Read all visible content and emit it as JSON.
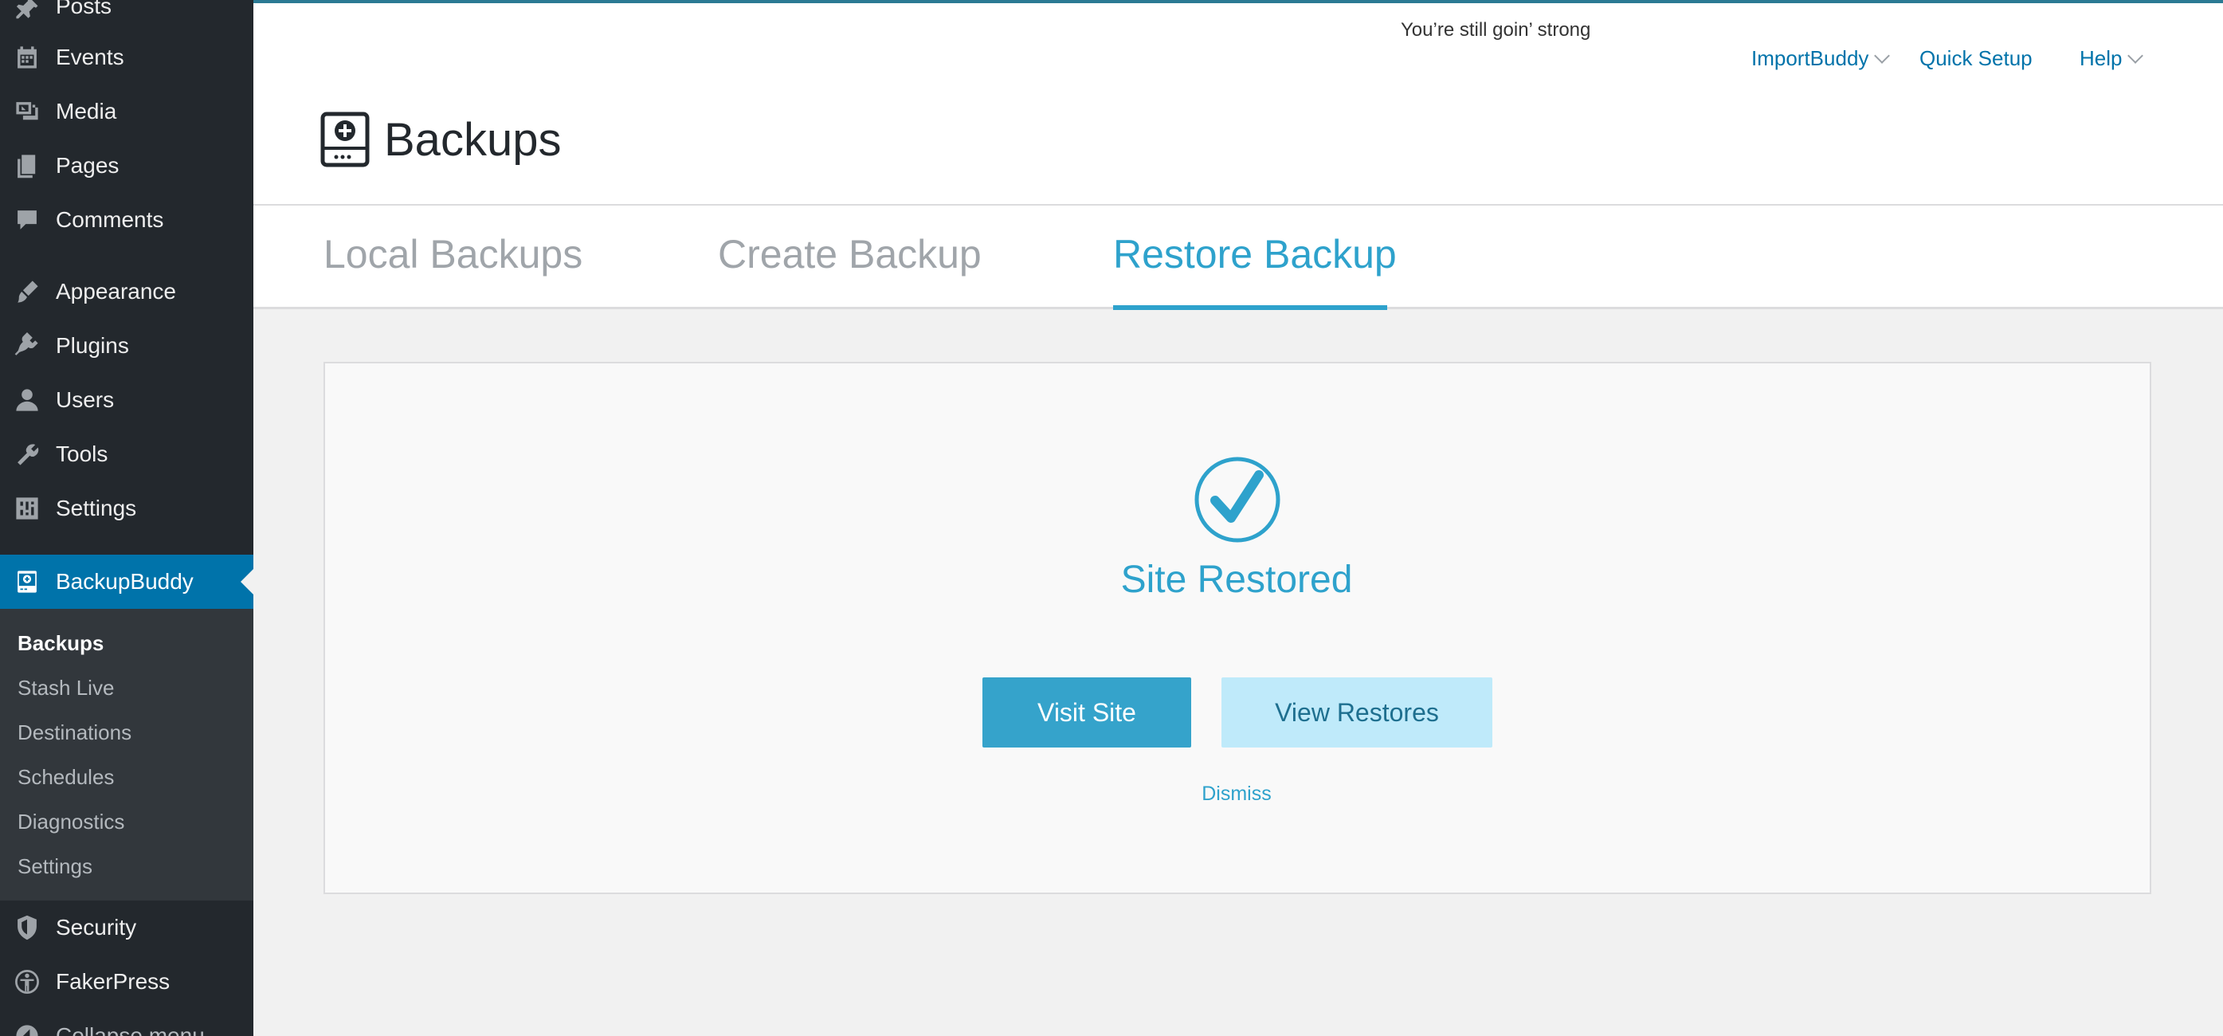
{
  "sidebar": {
    "items": [
      {
        "label": "Posts",
        "icon": "pushpin-icon"
      },
      {
        "label": "Events",
        "icon": "calendar-icon"
      },
      {
        "label": "Media",
        "icon": "media-icon"
      },
      {
        "label": "Pages",
        "icon": "pages-icon"
      },
      {
        "label": "Comments",
        "icon": "comment-icon"
      },
      {
        "label": "Appearance",
        "icon": "paintbrush-icon"
      },
      {
        "label": "Plugins",
        "icon": "plug-icon"
      },
      {
        "label": "Users",
        "icon": "user-icon"
      },
      {
        "label": "Tools",
        "icon": "wrench-icon"
      },
      {
        "label": "Settings",
        "icon": "sliders-icon"
      },
      {
        "label": "BackupBuddy",
        "icon": "backupbuddy-icon"
      },
      {
        "label": "Security",
        "icon": "shield-icon"
      },
      {
        "label": "FakerPress",
        "icon": "fakerpress-icon"
      },
      {
        "label": "Collapse menu",
        "icon": "collapse-icon"
      }
    ],
    "submenu": [
      "Backups",
      "Stash Live",
      "Destinations",
      "Schedules",
      "Diagnostics",
      "Settings"
    ],
    "submenu_current": "Backups"
  },
  "header": {
    "notice": "You’re still goin’ strong",
    "links": {
      "importbuddy": "ImportBuddy",
      "quick_setup": "Quick Setup",
      "help": "Help"
    },
    "title": "Backups"
  },
  "tabs": [
    {
      "label": "Local Backups",
      "active": false
    },
    {
      "label": "Create Backup",
      "active": false
    },
    {
      "label": "Restore Backup",
      "active": true
    }
  ],
  "restore": {
    "status": "Site Restored",
    "visit_button": "Visit Site",
    "view_button": "View Restores",
    "dismiss": "Dismiss"
  },
  "colors": {
    "sidebar_bg": "#23282d",
    "submenu_bg": "#32373c",
    "wp_blue": "#0073aa",
    "accent": "#2ea2cc",
    "button_primary": "#35a3cb",
    "button_secondary": "#bfeafa"
  }
}
